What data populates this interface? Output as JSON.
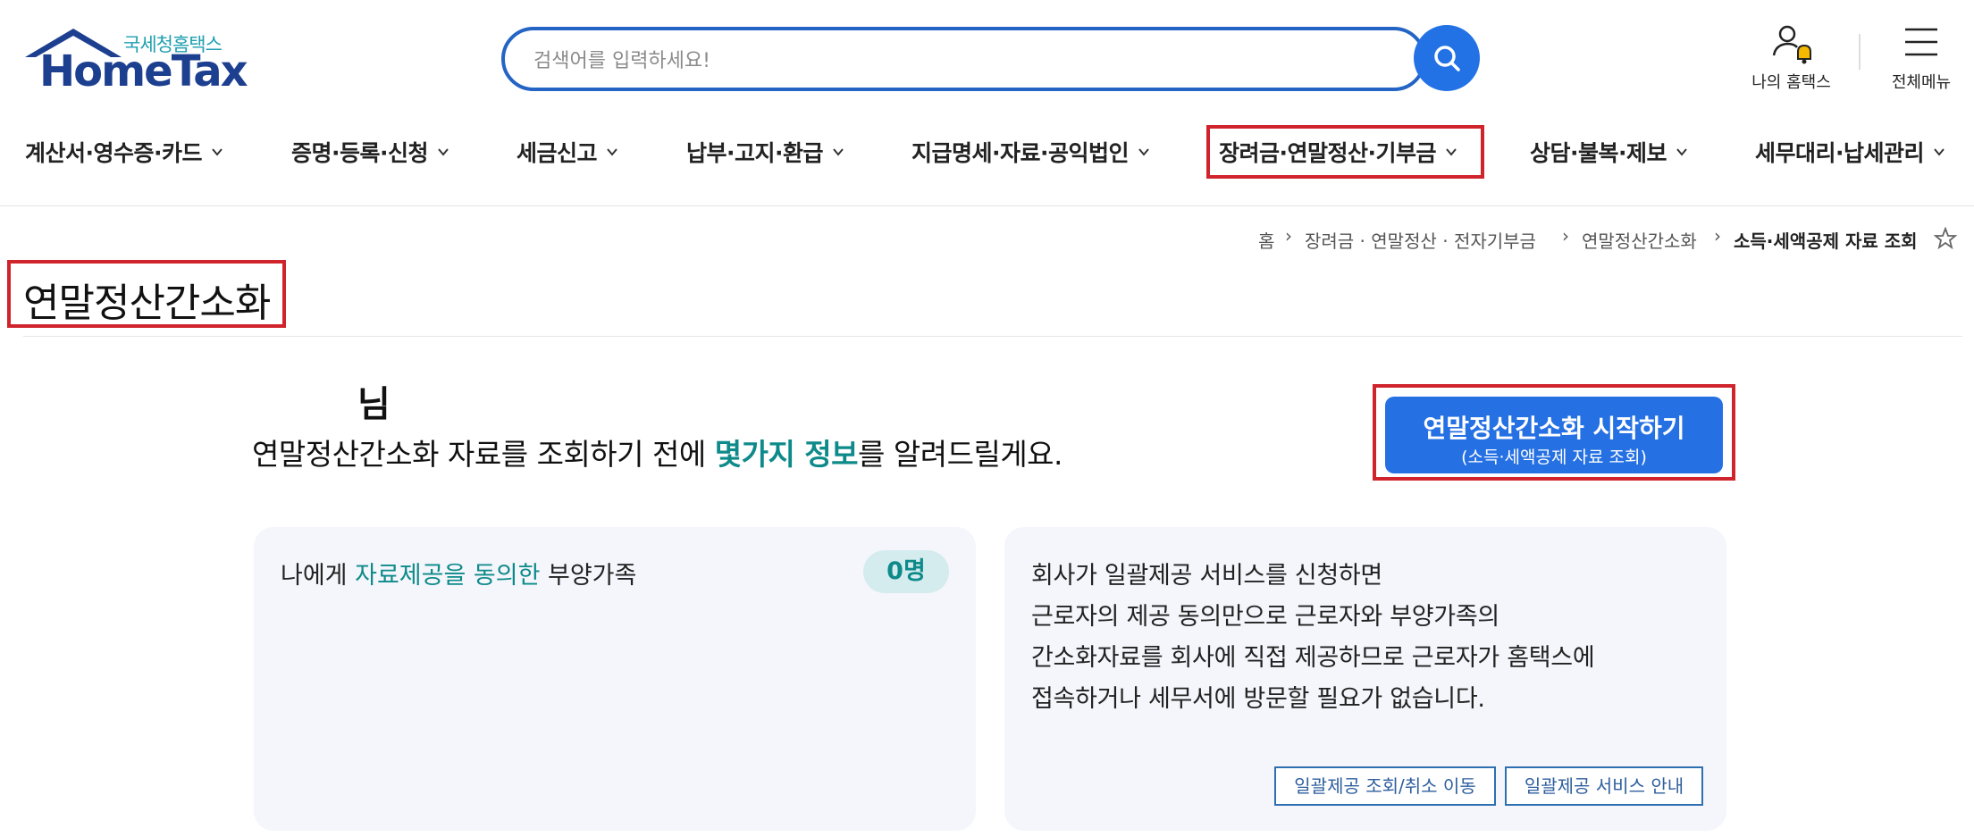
{
  "header": {
    "logo_sub": "국세청홈택스",
    "logo_main": "HomeTax",
    "search_placeholder": "검색어를 입력하세요!",
    "my_home_label": "나의 홈택스",
    "all_menu_label": "전체메뉴"
  },
  "gnb": [
    {
      "label": "계산서·영수증·카드"
    },
    {
      "label": "증명·등록·신청"
    },
    {
      "label": "세금신고"
    },
    {
      "label": "납부·고지·환급"
    },
    {
      "label": "지급명세·자료·공익법인"
    },
    {
      "label": "장려금·연말정산·기부금"
    },
    {
      "label": "상담·불복·제보"
    },
    {
      "label": "세무대리·납세관리"
    }
  ],
  "breadcrumb": {
    "home": "홈",
    "c1": "장려금 · 연말정산 · 전자기부금",
    "c2": "연말정산간소화",
    "current": "소득·세액공제 자료 조회"
  },
  "page_title": "연말정산간소화",
  "intro": {
    "nim": "님",
    "before": "연말정산간소화 자료를 조회하기 전에 ",
    "highlight": "몇가지 정보",
    "after": "를 알려드릴게요."
  },
  "start_button": {
    "line1": "연말정산간소화 시작하기",
    "line2": "(소득·세액공제 자료 조회)"
  },
  "dependents_card": {
    "prefix": "나에게 ",
    "highlight": "자료제공을 동의한",
    "suffix": " 부양가족",
    "count": "0명"
  },
  "bulk_card": {
    "lines": [
      "회사가 일괄제공 서비스를 신청하면",
      "근로자의 제공 동의만으로 근로자와 부양가족의",
      "간소화자료를 회사에 직접 제공하므로 근로자가 홈택스에",
      "접속하거나 세무서에 방문할 필요가 없습니다."
    ],
    "btn_lookup": "일괄제공 조회/취소 이동",
    "btn_guide": "일괄제공 서비스 안내"
  },
  "colors": {
    "brand_blue": "#2570e3",
    "highlight_red": "#d0242c",
    "teal": "#0e8a8a"
  }
}
